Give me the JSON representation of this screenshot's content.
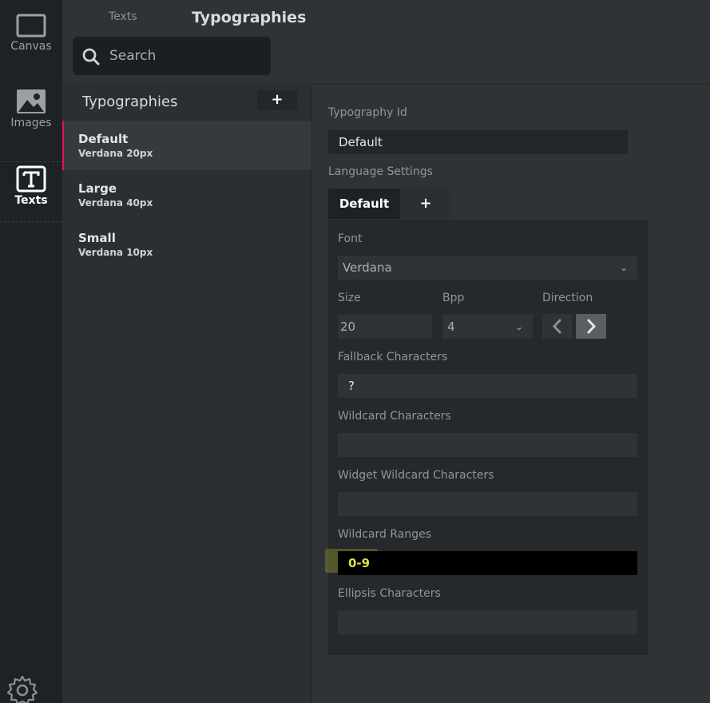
{
  "rail": {
    "items": [
      {
        "label": "Canvas",
        "icon": "canvas-icon"
      },
      {
        "label": "Images",
        "icon": "image-icon"
      },
      {
        "label": "Texts",
        "icon": "text-icon"
      }
    ],
    "settings_icon": "gear-icon"
  },
  "header": {
    "crumb": "Texts",
    "title": "Typographies",
    "search_placeholder": "Search"
  },
  "list": {
    "heading": "Typographies",
    "add_label": "+",
    "items": [
      {
        "name": "Default",
        "sub": "Verdana  20px"
      },
      {
        "name": "Large",
        "sub": "Verdana  40px"
      },
      {
        "name": "Small",
        "sub": "Verdana  10px"
      }
    ]
  },
  "detail": {
    "typography_id_label": "Typography Id",
    "typography_id_value": "Default",
    "language_settings_label": "Language Settings",
    "tabs": [
      {
        "label": "Default"
      },
      {
        "label": "+"
      }
    ],
    "font_label": "Font",
    "font_value": "Verdana",
    "size_label": "Size",
    "size_value": "20",
    "bpp_label": "Bpp",
    "bpp_value": "4",
    "direction_label": "Direction",
    "fallback_label": "Fallback Characters",
    "fallback_value": "?",
    "wildcard_label": "Wildcard Characters",
    "wildcard_value": "",
    "widget_wildcard_label": "Widget Wildcard Characters",
    "widget_wildcard_value": "",
    "wildcard_ranges_label": "Wildcard Ranges",
    "wildcard_ranges_value": "0-9",
    "ellipsis_label": "Ellipsis Characters",
    "ellipsis_value": ""
  },
  "colors": {
    "accent": "#e0116b",
    "highlight_text": "#d8e24a"
  }
}
